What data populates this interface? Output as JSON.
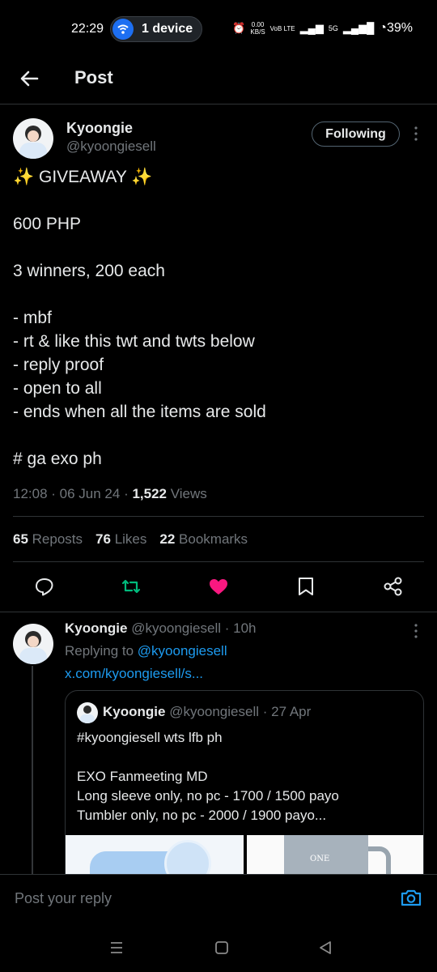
{
  "status_bar": {
    "time": "22:29",
    "device_pill": "1 device",
    "net_speed_top": "0.00",
    "net_speed_bottom": "KB/S",
    "network_types": "VoB LTE",
    "signal": "5G",
    "battery": "39%"
  },
  "header": {
    "back_icon": "arrow-left-icon",
    "title": "Post"
  },
  "post": {
    "author_name": "Kyoongie",
    "author_handle": "@kyoongiesell",
    "follow_label": "Following",
    "text": "✨ GIVEAWAY ✨\n\n600 PHP\n\n3 winners, 200 each\n\n- mbf\n- rt & like this twt and twts below\n- reply proof\n- open to all\n- ends when all the items are sold\n\n# ga exo ph",
    "time": "12:08",
    "date": "06 Jun 24",
    "views_count": "1,522",
    "views_label": "Views",
    "reposts_count": "65",
    "reposts_label": "Reposts",
    "likes_count": "76",
    "likes_label": "Likes",
    "bookmarks_count": "22",
    "bookmarks_label": "Bookmarks"
  },
  "actions": [
    {
      "icon": "reply-icon"
    },
    {
      "icon": "repost-icon",
      "color": "#00ba7c"
    },
    {
      "icon": "like-icon",
      "color": "#f91880"
    },
    {
      "icon": "bookmark-icon"
    },
    {
      "icon": "share-icon"
    }
  ],
  "reply": {
    "author_name": "Kyoongie",
    "author_handle": "@kyoongiesell",
    "age": "10h",
    "replying_to_label": "Replying to",
    "replying_to_handle": "@kyoongiesell",
    "link_text": "x.com/kyoongiesell/s...",
    "quote": {
      "author_name": "Kyoongie",
      "author_handle": "@kyoongiesell",
      "date": "27 Apr",
      "text": "#kyoongiesell wts lfb ph\n\nEXO Fanmeeting MD\nLong sleeve only, no pc - 1700 / 1500 payo\nTumbler only, no pc - 2000 / 1900 payo...",
      "image2_brand": "ONE"
    }
  },
  "reply_bar": {
    "placeholder": "Post your reply"
  },
  "colors": {
    "accent": "#1d9bf0",
    "repost": "#00ba7c",
    "like": "#f91880",
    "background": "#000000"
  }
}
